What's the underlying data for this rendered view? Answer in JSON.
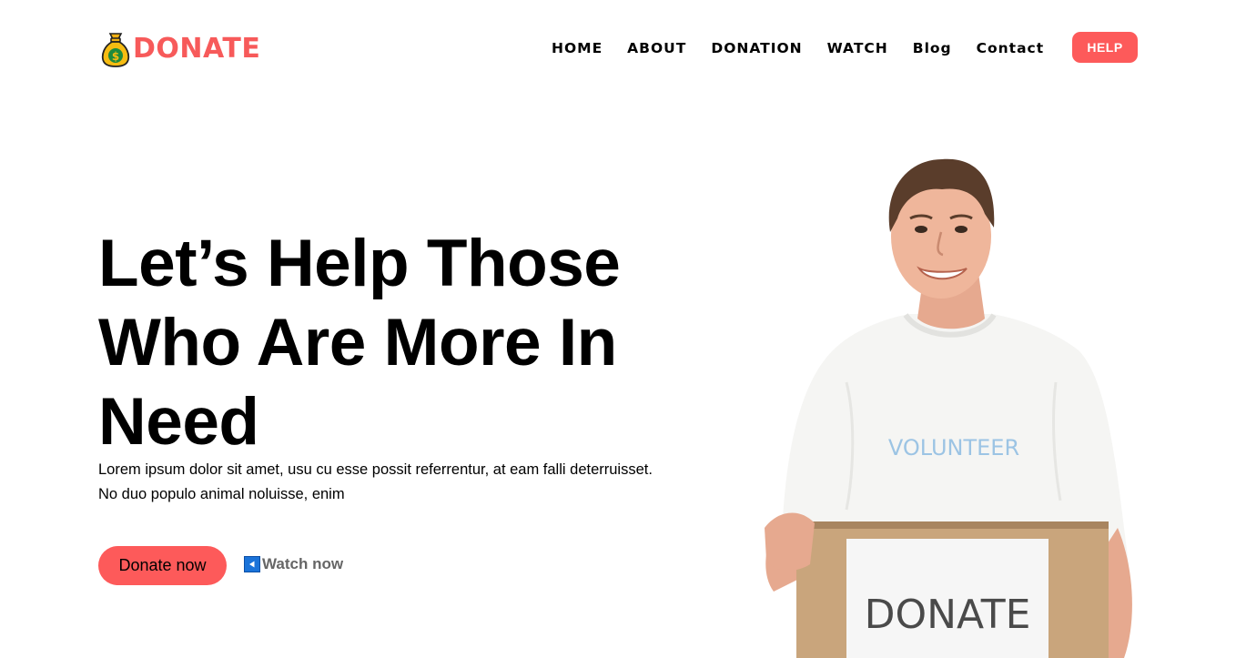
{
  "brand": {
    "name": "DONATE",
    "accent": "#fd5a5a",
    "icon": "money-bag-icon"
  },
  "nav": {
    "items": [
      {
        "label": "HOME"
      },
      {
        "label": "ABOUT"
      },
      {
        "label": "DONATION"
      },
      {
        "label": "WATCH"
      },
      {
        "label": "Blog"
      },
      {
        "label": "Contact"
      }
    ],
    "help_label": "HELP"
  },
  "hero": {
    "title_lines": [
      "Let’s Help Those",
      "Who Are More In",
      "Need"
    ],
    "text_lines": [
      "Lorem ipsum dolor sit amet, usu cu esse possit referrentur, at eam falli deterruisset.",
      "No duo populo animal noluisse, enim"
    ],
    "primary_cta": "Donate now",
    "secondary_cta": "Watch now",
    "secondary_icon": "play-icon"
  },
  "image": {
    "shirt_text": "VOLUNTEER",
    "box_sign_text": "DONATE"
  }
}
